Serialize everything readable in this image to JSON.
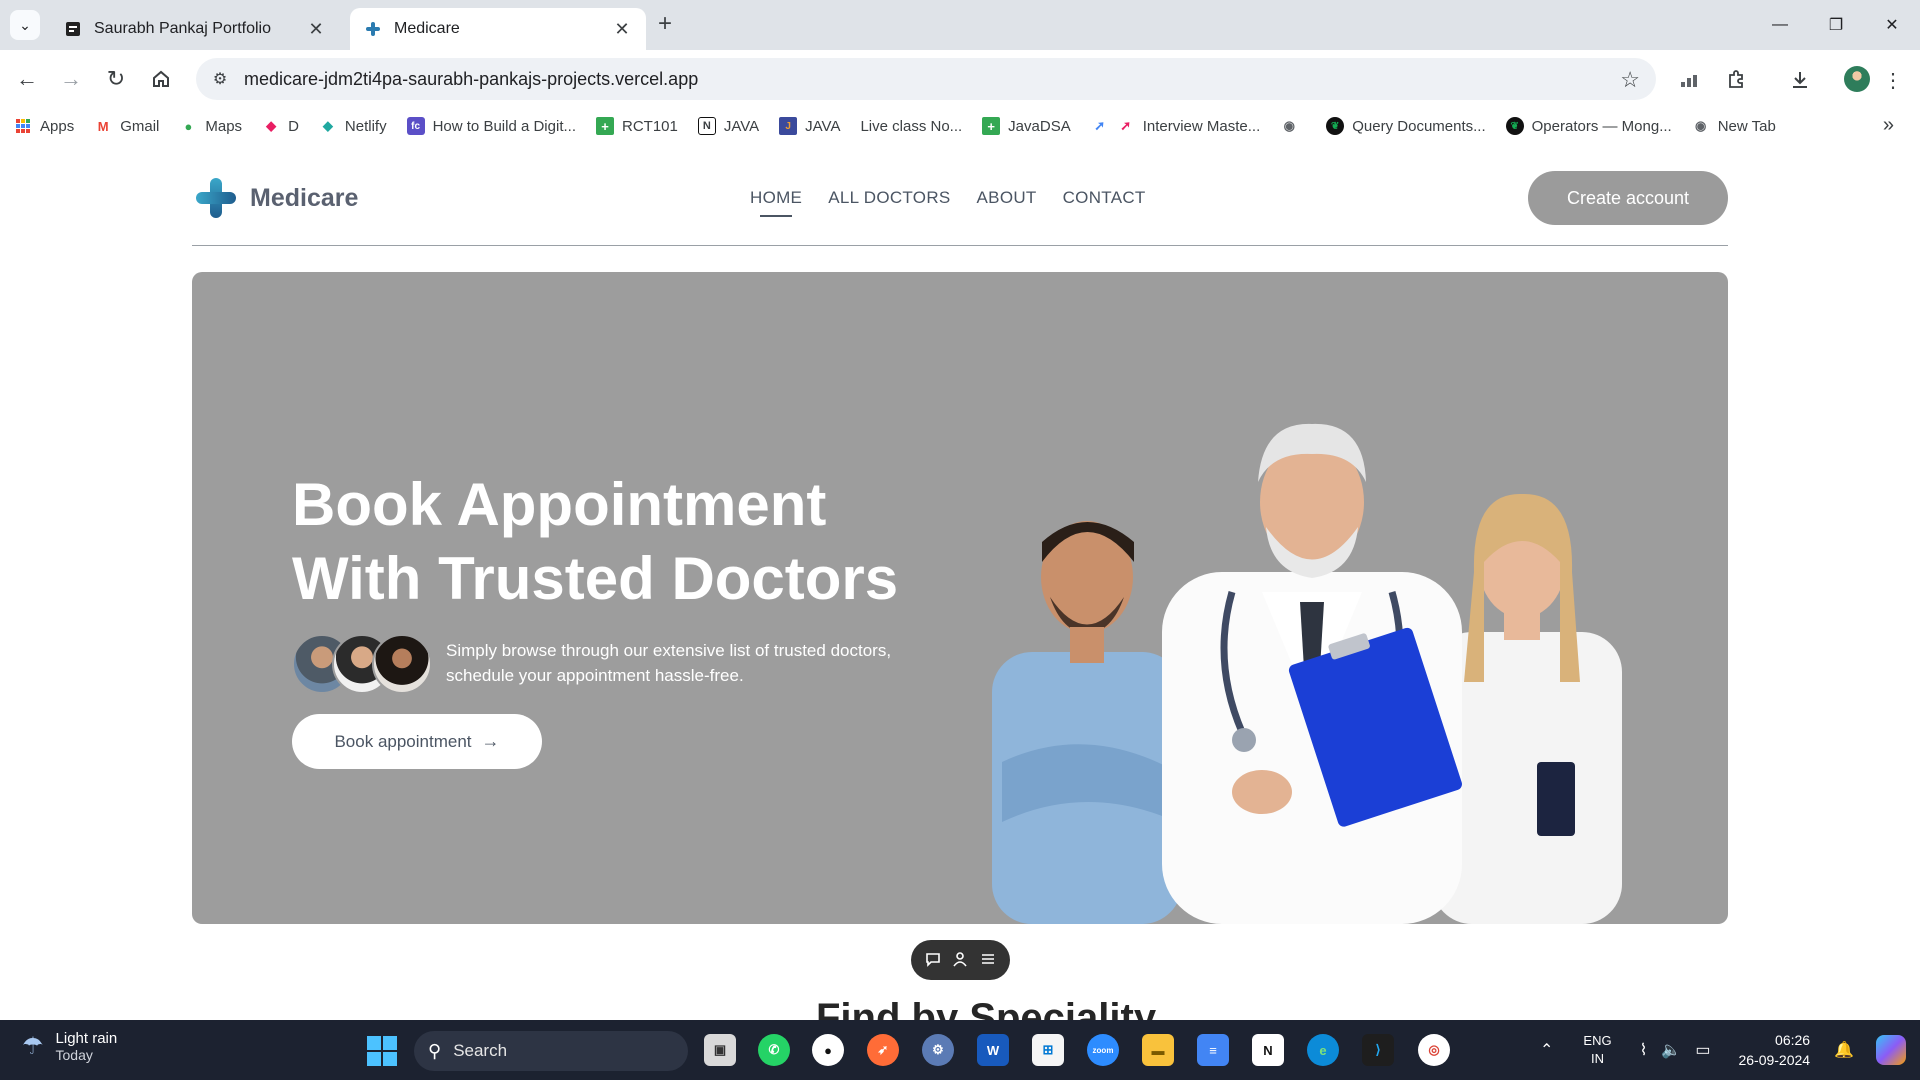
{
  "browser": {
    "tabs": [
      {
        "title": "Saurabh Pankaj Portfolio",
        "favicon": "portfolio-icon",
        "active": false
      },
      {
        "title": "Medicare",
        "favicon": "medical-cross-icon",
        "active": true
      }
    ],
    "url": "medicare-jdm2ti4pa-saurabh-pankajs-projects.vercel.app",
    "bookmarks": [
      {
        "label": "Apps",
        "icon": "apps-grid-icon",
        "color": "#ea4335"
      },
      {
        "label": "Gmail",
        "icon": "gmail-icon",
        "color": "#ea4335"
      },
      {
        "label": "Maps",
        "icon": "maps-pin-icon",
        "color": "#34a853"
      },
      {
        "label": "D",
        "icon": "d-bookmark-icon",
        "color": "#e91e63"
      },
      {
        "label": "Netlify",
        "icon": "netlify-icon",
        "color": "#20a8a0"
      },
      {
        "label": "How to Build a Digit...",
        "icon": "doc-icon",
        "color": "#5b4fc7"
      },
      {
        "label": "RCT101",
        "icon": "plus-green-icon",
        "color": "#34a853"
      },
      {
        "label": "JAVA",
        "icon": "notion-icon",
        "color": "#111111"
      },
      {
        "label": "JAVA",
        "icon": "java-icon",
        "color": "#3b4a9c"
      },
      {
        "label": "Live class No...",
        "icon": "",
        "color": ""
      },
      {
        "label": "JavaDSA",
        "icon": "plus-green-icon",
        "color": "#34a853"
      },
      {
        "label": "Interview Maste...",
        "icon": "rocket-icon",
        "color": "#4285f4"
      },
      {
        "label": "",
        "icon": "globe-icon",
        "color": "#5f6368"
      },
      {
        "label": "Query Documents...",
        "icon": "mongodb-icon",
        "color": "#0b8c3c"
      },
      {
        "label": "Operators — Mong...",
        "icon": "mongodb-icon",
        "color": "#0b8c3c"
      },
      {
        "label": "New Tab",
        "icon": "globe-icon",
        "color": "#5f6368"
      }
    ]
  },
  "site": {
    "brand": "Medicare",
    "nav": [
      {
        "label": "HOME",
        "active": true
      },
      {
        "label": "ALL DOCTORS",
        "active": false
      },
      {
        "label": "ABOUT",
        "active": false
      },
      {
        "label": "CONTACT",
        "active": false
      }
    ],
    "create_account": "Create account",
    "hero": {
      "title_line1": "Book Appointment",
      "title_line2": "With Trusted Doctors",
      "subtitle_line1": "Simply browse through our extensive list of trusted doctors,",
      "subtitle_line2": "schedule your appointment hassle-free.",
      "cta": "Book appointment",
      "cta_icon": "arrow-right-icon"
    },
    "next_section_heading": "Find by Speciality",
    "colors": {
      "hero_bg": "#9d9d9d",
      "brand_gradient_start": "#3aa7c9",
      "brand_gradient_end": "#1f5d8e",
      "button_gray": "#9b9b9b"
    }
  },
  "taskbar": {
    "weather_title": "Light rain",
    "weather_sub": "Today",
    "search_placeholder": "Search",
    "lang_line1": "ENG",
    "lang_line2": "IN",
    "time": "06:26",
    "date": "26-09-2024"
  }
}
